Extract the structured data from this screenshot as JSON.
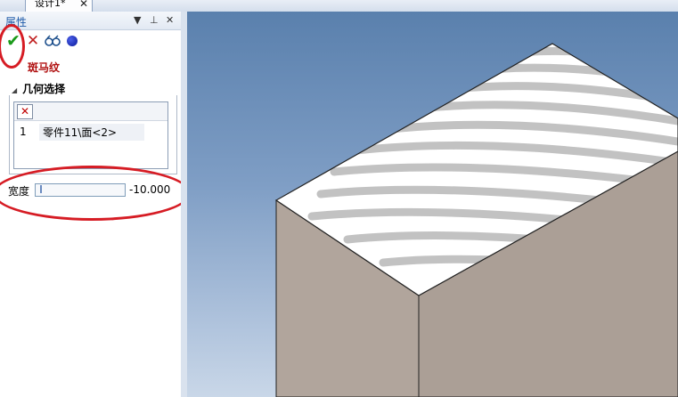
{
  "document_tab": {
    "label": "设计1*"
  },
  "panel": {
    "title": "属性",
    "feature_title": "斑马纹",
    "geometry_group": {
      "title": "几何选择",
      "items": [
        {
          "index": "1",
          "value": "零件11\\面<2>"
        }
      ]
    },
    "width": {
      "label": "宽度",
      "value": "-10.000",
      "fraction": 0.02
    }
  },
  "icons": {
    "ok": "check-icon",
    "cancel": "cross-icon",
    "preview": "glasses-icon",
    "option": "blue-dot-icon",
    "delete": "delete-x-icon"
  },
  "colors": {
    "accent_title": "#1e5aa8",
    "feature_red": "#b01010",
    "highlight_ring": "#d61c24",
    "box_side": "#ab9f96",
    "box_top": "#ffffff",
    "stripe": "#c4c4c4"
  }
}
